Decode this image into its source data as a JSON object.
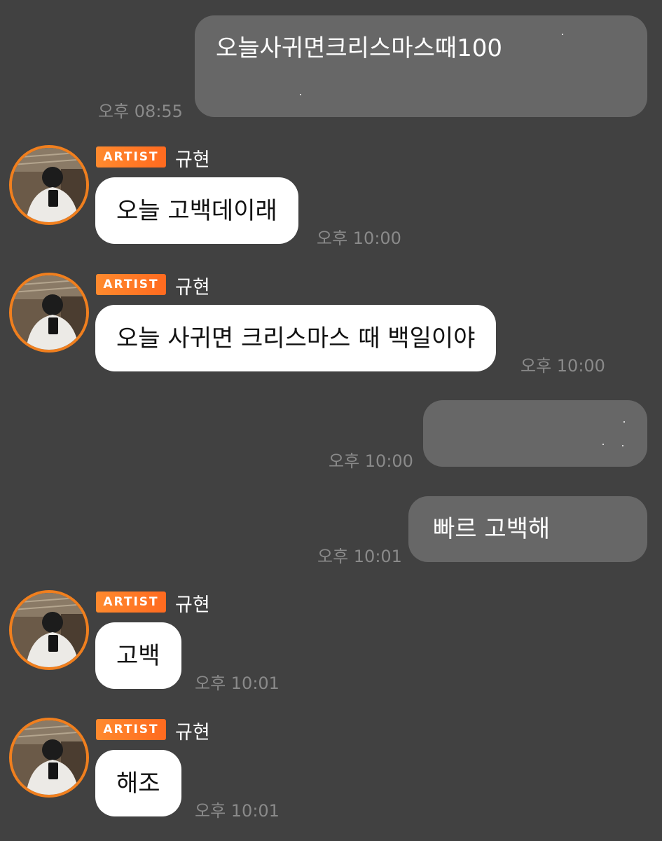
{
  "messages": [
    {
      "type": "outgoing",
      "text": "오늘사귀면크리스마스때100",
      "time": "오후 08:55"
    },
    {
      "type": "incoming",
      "badge": "ARTIST",
      "sender": "규현",
      "text": "오늘 고백데이래",
      "time": "오후 10:00"
    },
    {
      "type": "incoming",
      "badge": "ARTIST",
      "sender": "규현",
      "text": "오늘 사귀면 크리스마스 때 백일이야",
      "time": "오후 10:00"
    },
    {
      "type": "outgoing",
      "text": "",
      "time": "오후 10:00"
    },
    {
      "type": "outgoing",
      "text": "빠르 고백해",
      "time": "오후 10:01"
    },
    {
      "type": "incoming",
      "badge": "ARTIST",
      "sender": "규현",
      "text": "고백",
      "time": "오후 10:01"
    },
    {
      "type": "incoming",
      "badge": "ARTIST",
      "sender": "규현",
      "text": "해조",
      "time": "오후 10:01"
    }
  ],
  "colors": {
    "background": "#414141",
    "outgoing_bubble": "#676767",
    "incoming_bubble": "#ffffff",
    "accent": "#f07f1e",
    "timestamp": "#8a8a8a"
  },
  "icons": {
    "avatar": "profile-photo-avatar"
  }
}
